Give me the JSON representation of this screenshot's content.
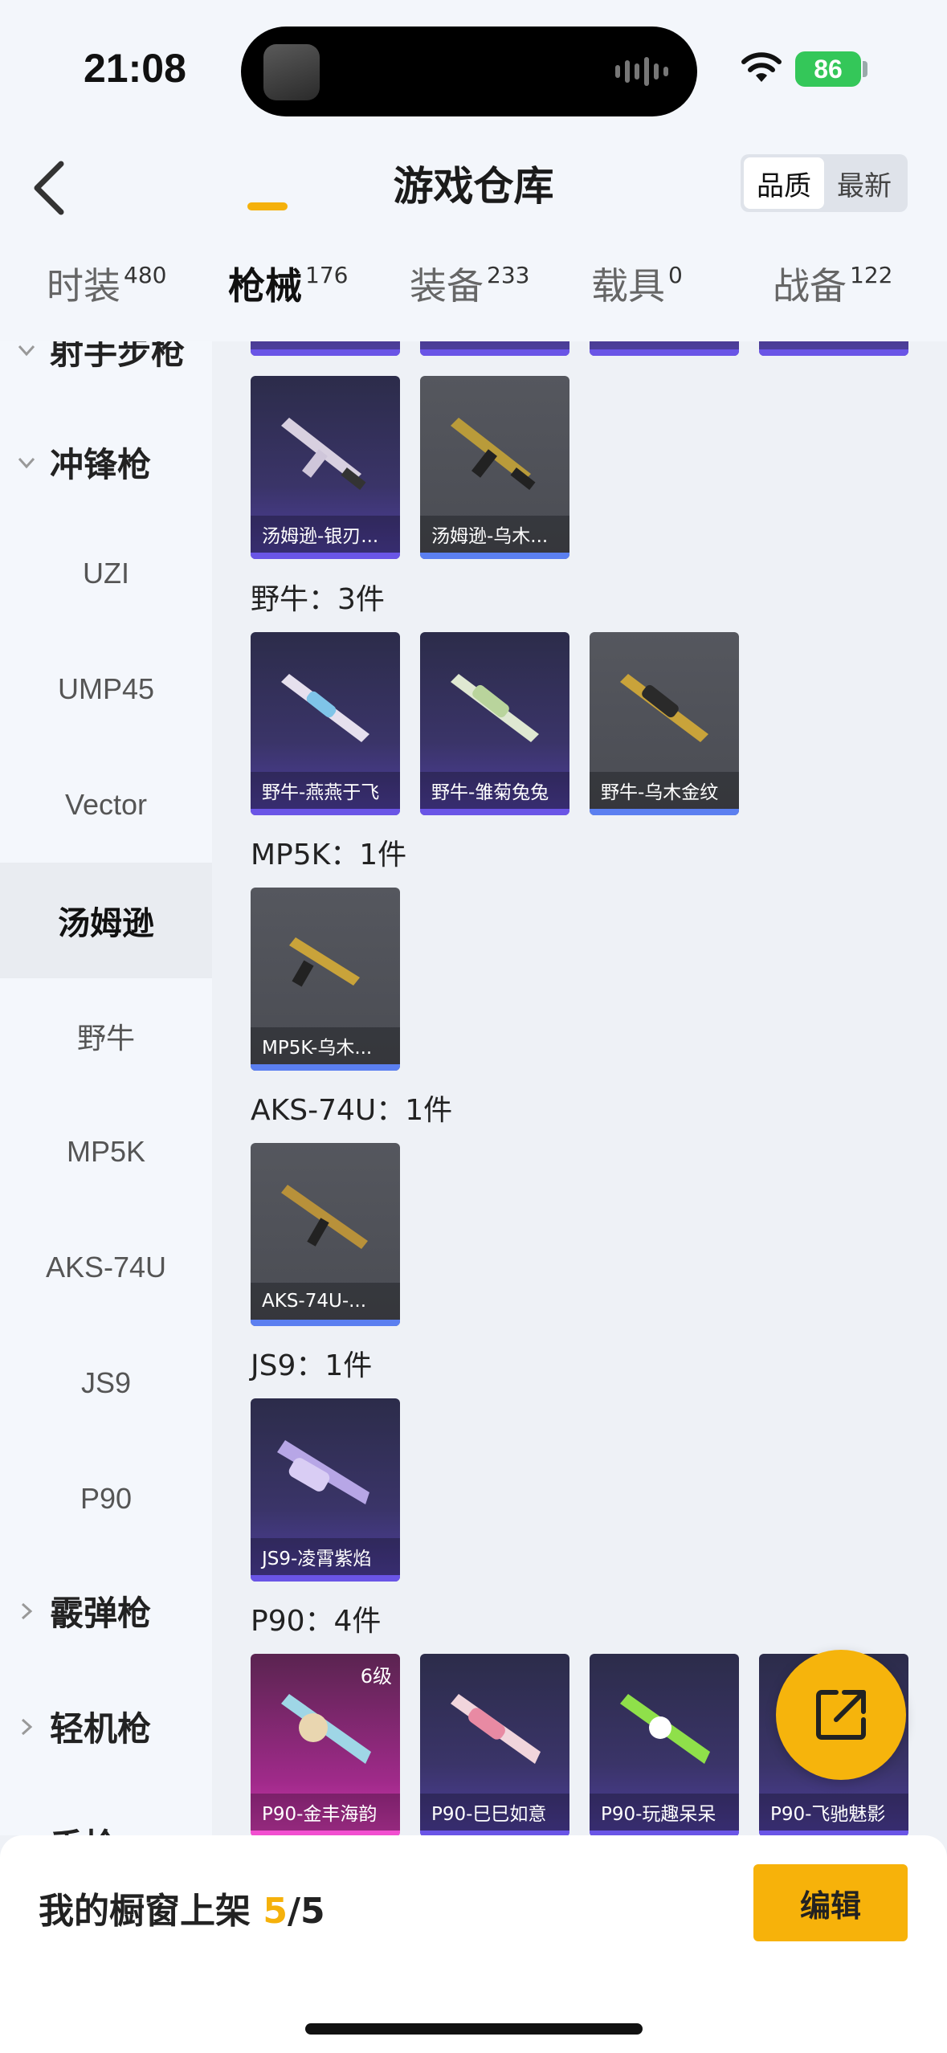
{
  "status": {
    "time": "21:08",
    "battery": "86"
  },
  "header": {
    "title": "游戏仓库",
    "sort_quality": "品质",
    "sort_newest": "最新"
  },
  "tabs": [
    {
      "label": "时装",
      "count": "480"
    },
    {
      "label": "枪械",
      "count": "176"
    },
    {
      "label": "装备",
      "count": "233"
    },
    {
      "label": "载具",
      "count": "0"
    },
    {
      "label": "战备",
      "count": "122"
    }
  ],
  "sidebar": {
    "cat_top": "射手步枪",
    "cat_smg": "冲锋枪",
    "items": [
      "UZI",
      "UMP45",
      "Vector",
      "汤姆逊",
      "野牛",
      "MP5K",
      "AKS-74U",
      "JS9",
      "P90"
    ],
    "cat_shotgun": "霰弹枪",
    "cat_lmg": "轻机枪",
    "cat_pistol": "手枪"
  },
  "groups": [
    {
      "label": "",
      "cards": [
        {
          "name": "汤姆逊-银刃...",
          "rarity": "purple"
        },
        {
          "name": "汤姆逊-乌木...",
          "rarity": "gray"
        }
      ]
    },
    {
      "label": "野牛：3件",
      "cards": [
        {
          "name": "野牛-燕燕于飞",
          "rarity": "purple"
        },
        {
          "name": "野牛-雏菊兔兔",
          "rarity": "purple"
        },
        {
          "name": "野牛-乌木金纹",
          "rarity": "gray"
        }
      ]
    },
    {
      "label": "MP5K：1件",
      "cards": [
        {
          "name": "MP5K-乌木...",
          "rarity": "gray"
        }
      ]
    },
    {
      "label": "AKS-74U：1件",
      "cards": [
        {
          "name": "AKS-74U-...",
          "rarity": "gray"
        }
      ]
    },
    {
      "label": "JS9：1件",
      "cards": [
        {
          "name": "JS9-凌霄紫焰",
          "rarity": "purple"
        }
      ]
    },
    {
      "label": "P90：4件",
      "cards": [
        {
          "name": "P90-金丰海韵",
          "rarity": "pink",
          "level": "6级"
        },
        {
          "name": "P90-巳巳如意",
          "rarity": "purple"
        },
        {
          "name": "P90-玩趣呆呆",
          "rarity": "purple"
        },
        {
          "name": "P90-飞驰魅影",
          "rarity": "purple"
        }
      ]
    }
  ],
  "footer": {
    "shelf_label": "我的橱窗上架 ",
    "shelf_used": "5",
    "shelf_total": "/5",
    "edit_label": "编辑"
  },
  "colors": {
    "accent": "#f5b10b",
    "purple_card": "#3a3468",
    "gray_card": "#4a4c53",
    "pink_card": "#a02a8a"
  }
}
